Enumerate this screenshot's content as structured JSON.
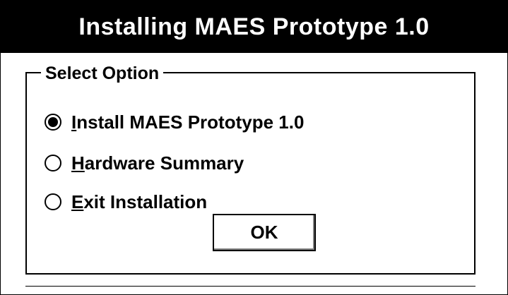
{
  "window": {
    "title": "Installing MAES Prototype 1.0"
  },
  "group": {
    "label": "Select Option",
    "options": [
      {
        "mnemonic": "I",
        "rest": "nstall MAES Prototype 1.0",
        "selected": true
      },
      {
        "mnemonic": "H",
        "rest": "ardware Summary",
        "selected": false
      },
      {
        "mnemonic": "E",
        "rest": "xit Installation",
        "selected": false
      }
    ]
  },
  "buttons": {
    "ok_label": "OK"
  },
  "colors": {
    "titlebar_bg": "#000000",
    "titlebar_text": "#ffffff",
    "window_bg": "#ffffff"
  }
}
